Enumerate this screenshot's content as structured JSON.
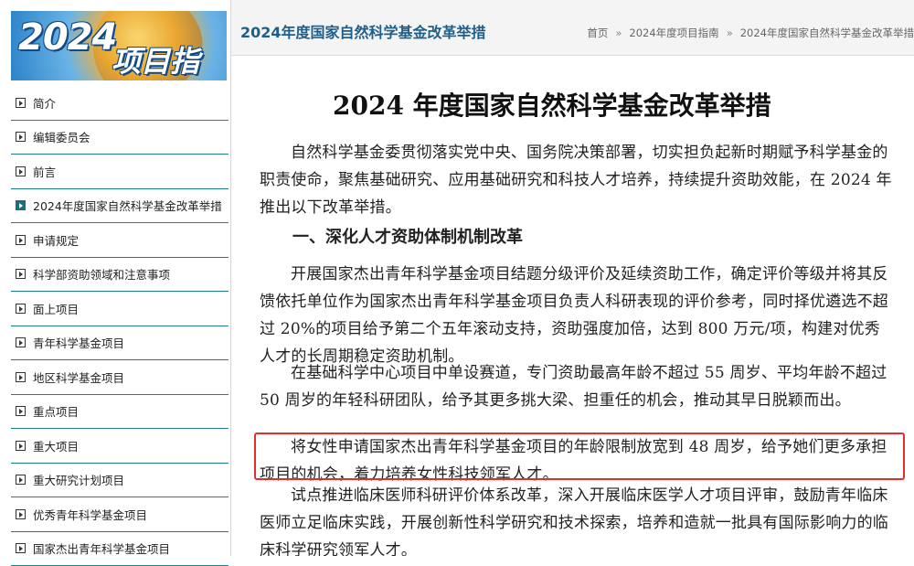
{
  "banner": {
    "year": "2024",
    "text": "项目指南"
  },
  "sidebar": {
    "items": [
      {
        "label": "简介"
      },
      {
        "label": "编辑委员会"
      },
      {
        "label": "前言"
      },
      {
        "label": "2024年度国家自然科学基金改革举措"
      },
      {
        "label": "申请规定"
      },
      {
        "label": "科学部资助领域和注意事项"
      },
      {
        "label": "面上项目"
      },
      {
        "label": "青年科学基金项目"
      },
      {
        "label": "地区科学基金项目"
      },
      {
        "label": "重点项目"
      },
      {
        "label": "重大项目"
      },
      {
        "label": "重大研究计划项目"
      },
      {
        "label": "优秀青年科学基金项目"
      },
      {
        "label": "国家杰出青年科学基金项目"
      }
    ],
    "active_index": 3
  },
  "header": {
    "title": "2024年度国家自然科学基金改革举措",
    "breadcrumb": [
      "首页",
      "2024年度项目指南",
      "2024年度国家自然科学基金改革举措"
    ],
    "separator": "»"
  },
  "article": {
    "heading": "2024 年度国家自然科学基金改革举措",
    "intro": "自然科学基金委贯彻落实党中央、国务院决策部署，切实担负起新时期赋予科学基金的职责使命，聚焦基础研究、应用基础研究和科技人才培养，持续提升资助效能，在 2024 年推出以下改革举措。",
    "section1": "一、深化人才资助体制机制改革",
    "p1": "开展国家杰出青年科学基金项目结题分级评价及延续资助工作，确定评价等级并将其反馈依托单位作为国家杰出青年科学基金项目负责人科研表现的评价参考，同时择优遴选不超过 20%的项目给予第二个五年滚动支持，资助强度加倍，达到 800 万元/项，构建对优秀人才的长周期稳定资助机制。",
    "p2": "在基础科学中心项目中单设赛道，专门资助最高年龄不超过 55 周岁、平均年龄不超过 50 周岁的年轻科研团队，给予其更多挑大梁、担重任的机会，推动其早日脱颖而出。",
    "p3": "将女性申请国家杰出青年科学基金项目的年龄限制放宽到 48 周岁，给予她们更多承担项目的机会，着力培养女性科技领军人才。",
    "p4": "试点推进临床医师科研评价体系改革，深入开展临床医学人才项目评审，鼓励青年临床医师立足临床实践，开展创新性科学研究和技术探索，培养和造就一批具有国际影响力的临床科学研究领军人才。"
  },
  "colors": {
    "highlight_border": "#e0302e",
    "nav_divider": "#1f7f8a",
    "header_title": "#1d5f8a"
  }
}
